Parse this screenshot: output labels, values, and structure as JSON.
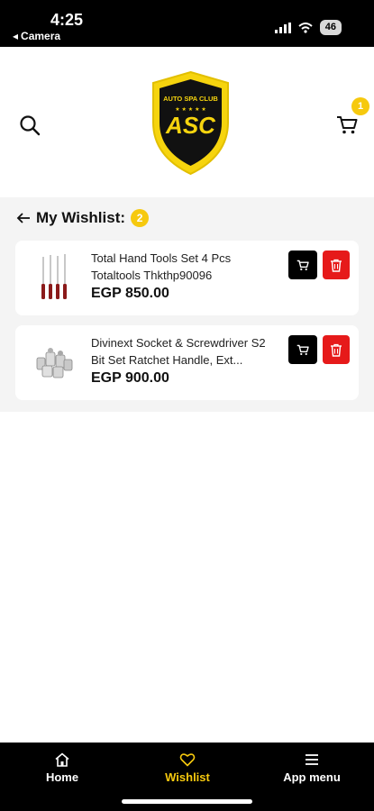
{
  "status_bar": {
    "time": "4:25",
    "back_app": "Camera",
    "battery": "46"
  },
  "header": {
    "cart_count": "1",
    "logo_text": "ASC",
    "logo_tagline": "AUTO SPA CLUB"
  },
  "wishlist": {
    "title": "My Wishlist:",
    "count": "2",
    "items": [
      {
        "name": "Total Hand Tools Set 4 Pcs Totaltools Thkthp90096",
        "price": "EGP 850.00"
      },
      {
        "name": "Divinext  Socket & Screwdriver S2 Bit Set Ratchet Handle, Ext...",
        "price": "EGP 900.00"
      }
    ]
  },
  "bottom_nav": {
    "home": "Home",
    "wishlist": "Wishlist",
    "menu": "App menu"
  },
  "colors": {
    "accent": "#f6c90e",
    "danger": "#e61a1a",
    "dark": "#000000"
  }
}
